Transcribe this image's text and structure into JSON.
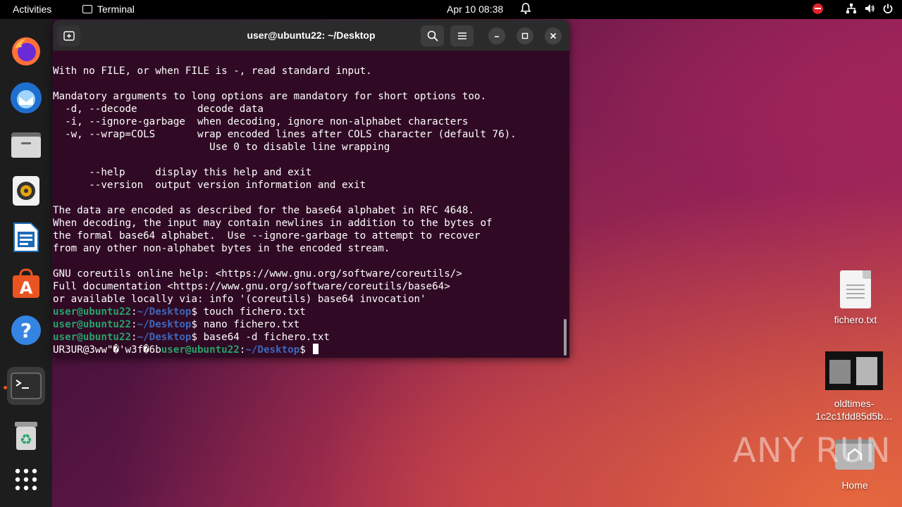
{
  "topbar": {
    "activities": "Activities",
    "app_name": "Terminal",
    "clock": "Apr 10  08:38"
  },
  "dock": {
    "apps": [
      "firefox",
      "thunderbird",
      "files",
      "rhythmbox",
      "libreoffice-writer",
      "app-center",
      "help",
      "terminal",
      "trash",
      "show-apps"
    ],
    "active": "terminal"
  },
  "terminal": {
    "title": "user@ubuntu22: ~/Desktop",
    "lines": [
      "With no FILE, or when FILE is -, read standard input.",
      "",
      "Mandatory arguments to long options are mandatory for short options too.",
      "  -d, --decode          decode data",
      "  -i, --ignore-garbage  when decoding, ignore non-alphabet characters",
      "  -w, --wrap=COLS       wrap encoded lines after COLS character (default 76).",
      "                          Use 0 to disable line wrapping",
      "",
      "      --help     display this help and exit",
      "      --version  output version information and exit",
      "",
      "The data are encoded as described for the base64 alphabet in RFC 4648.",
      "When decoding, the input may contain newlines in addition to the bytes of",
      "the formal base64 alphabet.  Use --ignore-garbage to attempt to recover",
      "from any other non-alphabet bytes in the encoded stream.",
      "",
      "GNU coreutils online help: <https://www.gnu.org/software/coreutils/>",
      "Full documentation <https://www.gnu.org/software/coreutils/base64>",
      "or available locally via: info '(coreutils) base64 invocation'"
    ],
    "prompt_user": "user@ubuntu22",
    "prompt_path": "~/Desktop",
    "commands": [
      "touch fichero.txt",
      "nano fichero.txt",
      "base64 -d fichero.txt"
    ],
    "output_line": "UR3UR@3ww\"�'w3f�6b"
  },
  "desktop": {
    "file1": "fichero.txt",
    "file2_line1": "oldtimes-",
    "file2_line2": "1c2c1fdd85d5b…",
    "home": "Home",
    "watermark": "ANY RUN"
  },
  "colors": {
    "terminal_bg": "#300a24",
    "prompt_user": "#26a269",
    "prompt_path": "#3f66b8",
    "accent": "#e95420"
  }
}
